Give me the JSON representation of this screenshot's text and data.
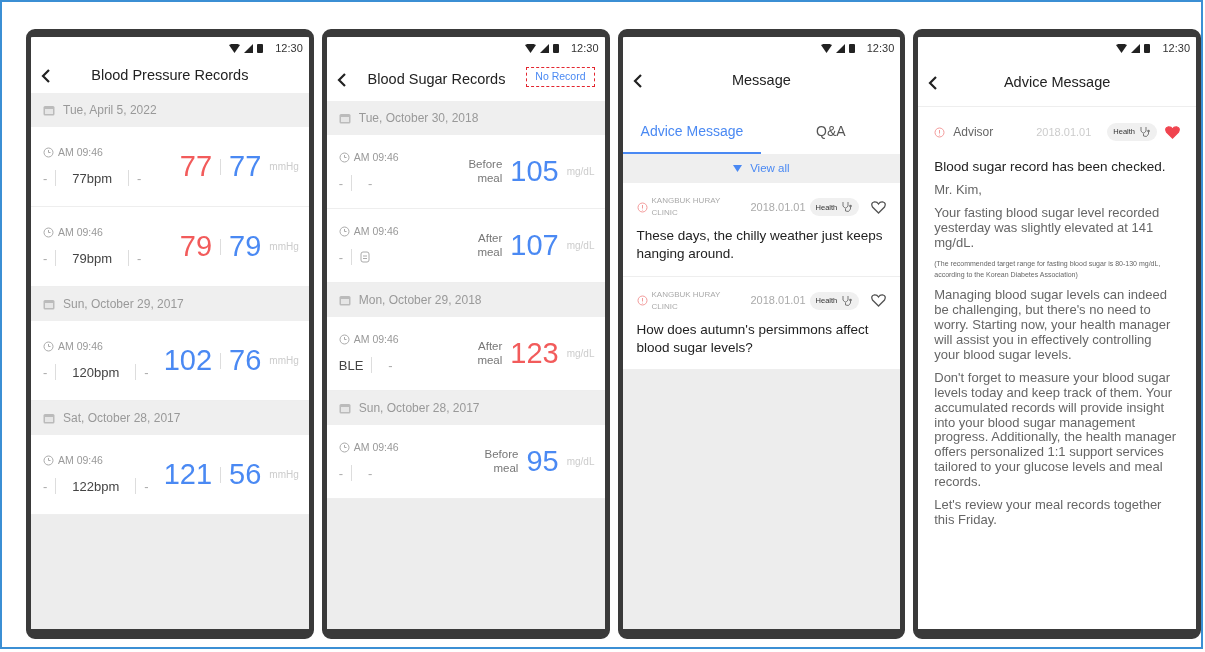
{
  "phones": [
    {
      "kind": "bp",
      "time": "12:30",
      "title": "Blood Pressure Records",
      "groups": [
        {
          "date": "Tue, April 5, 2022",
          "records": [
            {
              "time": "AM 09:46",
              "left": "-",
              "pulse": "77bpm",
              "right": "-",
              "systolic": "77",
              "systolic_high": true,
              "diastolic": "77",
              "unit": "mmHg"
            },
            {
              "time": "AM 09:46",
              "left": "-",
              "pulse": "79bpm",
              "right": "-",
              "systolic": "79",
              "systolic_high": true,
              "diastolic": "79",
              "unit": "mmHg"
            }
          ]
        },
        {
          "date": "Sun, October 29, 2017",
          "records": [
            {
              "time": "AM 09:46",
              "left": "-",
              "pulse": "120bpm",
              "right": "-",
              "systolic": "102",
              "systolic_high": false,
              "diastolic": "76",
              "unit": "mmHg"
            }
          ]
        },
        {
          "date": "Sat, October 28, 2017",
          "records": [
            {
              "time": "AM 09:46",
              "left": "-",
              "pulse": "122bpm",
              "right": "-",
              "systolic": "121",
              "systolic_high": false,
              "diastolic": "56",
              "unit": "mmHg"
            }
          ]
        }
      ]
    },
    {
      "kind": "sugar",
      "time": "12:30",
      "title": "Blood Sugar Records",
      "action": "No Record",
      "groups": [
        {
          "date": "Tue, October 30, 2018",
          "records": [
            {
              "time": "AM 09:46",
              "left": "-",
              "right": {
                "kind": "text",
                "text": "-"
              },
              "meal": "Before meal",
              "value": "105",
              "high": false,
              "unit": "mg/dL"
            },
            {
              "time": "AM 09:46",
              "left": "-",
              "right": {
                "kind": "device"
              },
              "meal": "After meal",
              "value": "107",
              "high": false,
              "unit": "mg/dL"
            }
          ]
        },
        {
          "date": "Mon, October 29, 2018",
          "records": [
            {
              "time": "AM 09:46",
              "left": "BLE",
              "right": {
                "kind": "text",
                "text": "-"
              },
              "meal": "After meal",
              "value": "123",
              "high": true,
              "unit": "mg/dL"
            }
          ]
        },
        {
          "date": "Sun, October 28, 2017",
          "records": [
            {
              "time": "AM 09:46",
              "left": "-",
              "right": {
                "kind": "text",
                "text": "-"
              },
              "meal": "Before meal",
              "value": "95",
              "high": false,
              "unit": "mg/dL"
            }
          ]
        }
      ]
    },
    {
      "kind": "messages",
      "time": "12:30",
      "title": "Message",
      "tabs": [
        {
          "label": "Advice Message",
          "selected": true
        },
        {
          "label": "Q&A",
          "selected": false
        }
      ],
      "view_all": "View all",
      "messages": [
        {
          "sender": "KANGBUK HURAY CLINIC",
          "date": "2018.01.01",
          "tag": "Health",
          "liked": false,
          "text": "These days, the chilly weather just keeps hanging around."
        },
        {
          "sender": "KANGBUK HURAY CLINIC",
          "date": "2018.01.01",
          "tag": "Health",
          "liked": false,
          "text": "How does autumn's persimmons affect blood sugar levels?"
        }
      ]
    },
    {
      "kind": "detail",
      "time": "12:30",
      "title": "Advice Message",
      "sender": "Advisor",
      "date": "2018.01.01",
      "tag": "Health",
      "liked": true,
      "paragraphs": [
        {
          "kind": "lead",
          "text": "Blood sugar record has been checked."
        },
        {
          "kind": "body",
          "text": "Mr. Kim,"
        },
        {
          "kind": "body",
          "text": "Your fasting blood sugar level recorded yesterday was slightly elevated at 141 mg/dL."
        },
        {
          "kind": "note",
          "text": "(The recommended target range for fasting blood sugar is 80-130 mg/dL, according to the Korean Diabetes Association)"
        },
        {
          "kind": "body",
          "text": "Managing blood sugar levels can indeed be challenging, but there's no need to worry. Starting now, your health manager will assist you in effectively controlling your blood sugar levels."
        },
        {
          "kind": "body",
          "text": "Don't forget to measure your blood sugar levels today and keep track of them. Your accumulated records will provide insight into your blood sugar management progress. Additionally, the health manager offers personalized 1:1 support services tailored to your glucose levels and meal records."
        },
        {
          "kind": "body",
          "text": "Let's review your meal records together this Friday."
        }
      ]
    }
  ]
}
